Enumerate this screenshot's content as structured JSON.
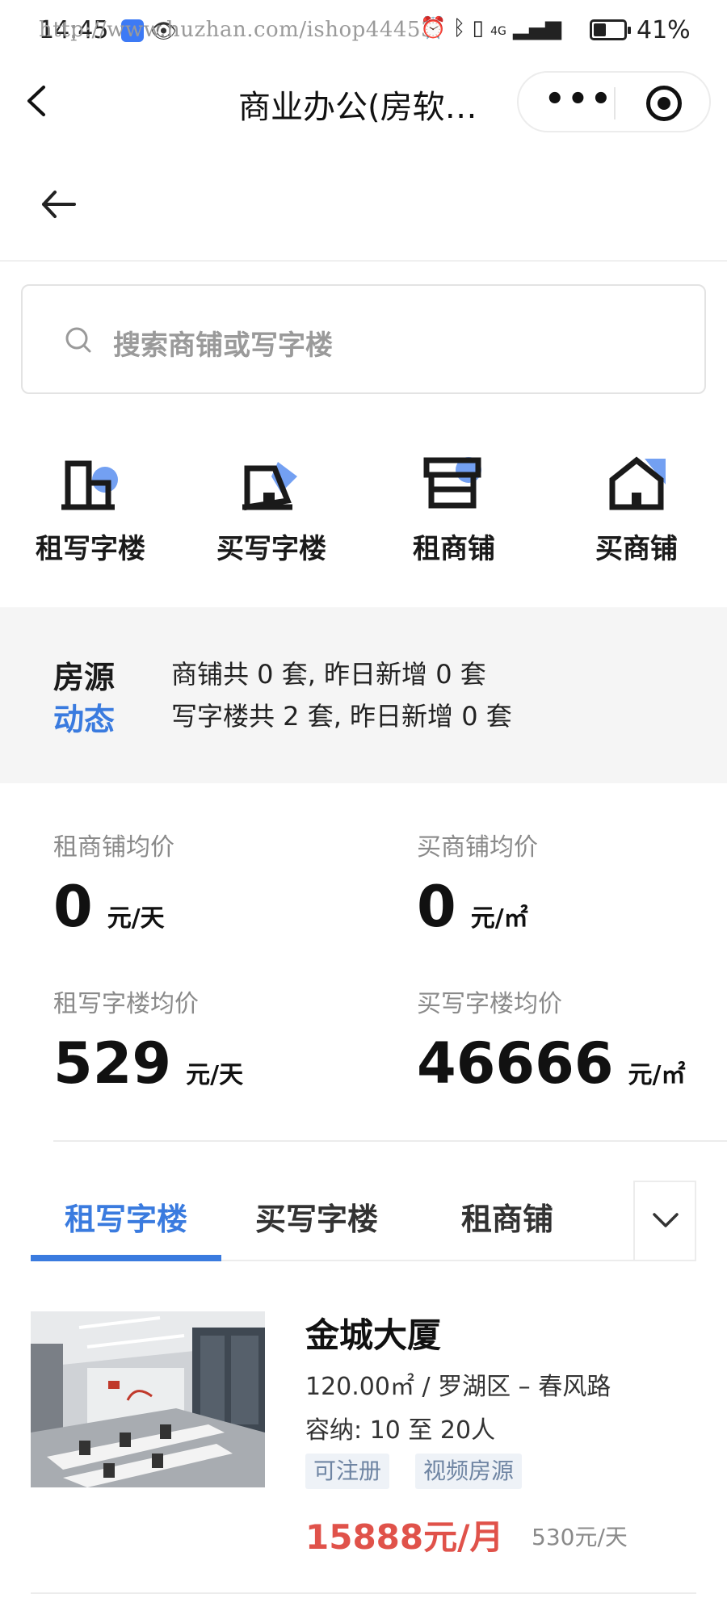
{
  "status_bar": {
    "time": "14:45",
    "watermark": "http://www.huzhan.com/ishop44453",
    "signal_label": "4G",
    "battery_percent": "41%",
    "battery_level": 0.41
  },
  "nav": {
    "title": "商业办公(房软…"
  },
  "search": {
    "placeholder": "搜索商铺或写字楼"
  },
  "categories": [
    {
      "label": "租写字楼",
      "icon": "office-rent-icon"
    },
    {
      "label": "买写字楼",
      "icon": "office-buy-icon"
    },
    {
      "label": "租商铺",
      "icon": "shop-rent-icon"
    },
    {
      "label": "买商铺",
      "icon": "shop-buy-icon"
    }
  ],
  "stats": {
    "title_line1": "房源",
    "title_line2": "动态",
    "shop_summary": "商铺共 0 套, 昨日新增 0 套",
    "office_summary": "写字楼共 2 套, 昨日新增 0 套"
  },
  "averages": [
    {
      "label": "租商铺均价",
      "value": "0",
      "unit": "元/天"
    },
    {
      "label": "买商铺均价",
      "value": "0",
      "unit": "元/㎡"
    },
    {
      "label": "租写字楼均价",
      "value": "529",
      "unit": "元/天"
    },
    {
      "label": "买写字楼均价",
      "value": "46666",
      "unit": "元/㎡"
    }
  ],
  "tabs": [
    {
      "label": "租写字楼",
      "active": true
    },
    {
      "label": "买写字楼",
      "active": false
    },
    {
      "label": "租商铺",
      "active": false
    }
  ],
  "listing": {
    "name": "金城大厦",
    "meta": "120.00㎡ / 罗湖区 – 春风路",
    "capacity": "容纳:  10 至 20人",
    "tags": [
      "可注册",
      "视频房源"
    ],
    "price_month": "15888元/月",
    "price_day": "530元/天"
  },
  "colors": {
    "accent": "#3a7bdf",
    "price": "#e0524a",
    "tag_bg": "#eef2f7",
    "tag_text": "#6f85a3"
  }
}
